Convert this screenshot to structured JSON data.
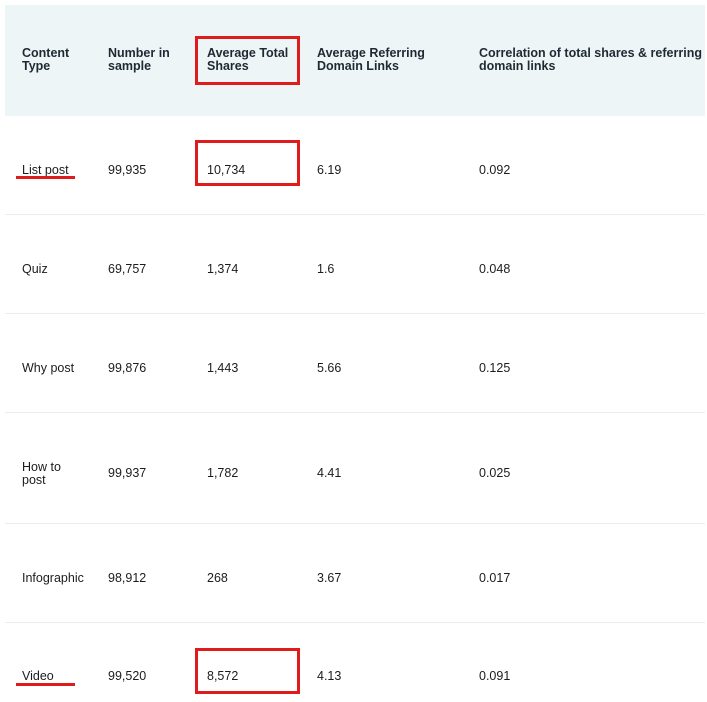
{
  "columns": [
    "Content Type",
    "Number in sample",
    "Average Total Shares",
    "Average Referring Domain Links",
    "Correlation of total shares & referring domain links"
  ],
  "rows": [
    {
      "content_type": "List post",
      "number_in_sample": "99,935",
      "avg_total_shares": "10,734",
      "avg_referring_domain_links": "6.19",
      "correlation": "0.092"
    },
    {
      "content_type": "Quiz",
      "number_in_sample": "69,757",
      "avg_total_shares": "1,374",
      "avg_referring_domain_links": "1.6",
      "correlation": "0.048"
    },
    {
      "content_type": "Why post",
      "number_in_sample": "99,876",
      "avg_total_shares": "1,443",
      "avg_referring_domain_links": "5.66",
      "correlation": "0.125"
    },
    {
      "content_type": "How to post",
      "number_in_sample": "99,937",
      "avg_total_shares": "1,782",
      "avg_referring_domain_links": "4.41",
      "correlation": "0.025"
    },
    {
      "content_type": "Infographic",
      "number_in_sample": "98,912",
      "avg_total_shares": "268",
      "avg_referring_domain_links": "3.67",
      "correlation": "0.017"
    },
    {
      "content_type": "Video",
      "number_in_sample": "99,520",
      "avg_total_shares": "8,572",
      "avg_referring_domain_links": "4.13",
      "correlation": "0.091"
    }
  ],
  "highlight_color": "#e01b1b"
}
